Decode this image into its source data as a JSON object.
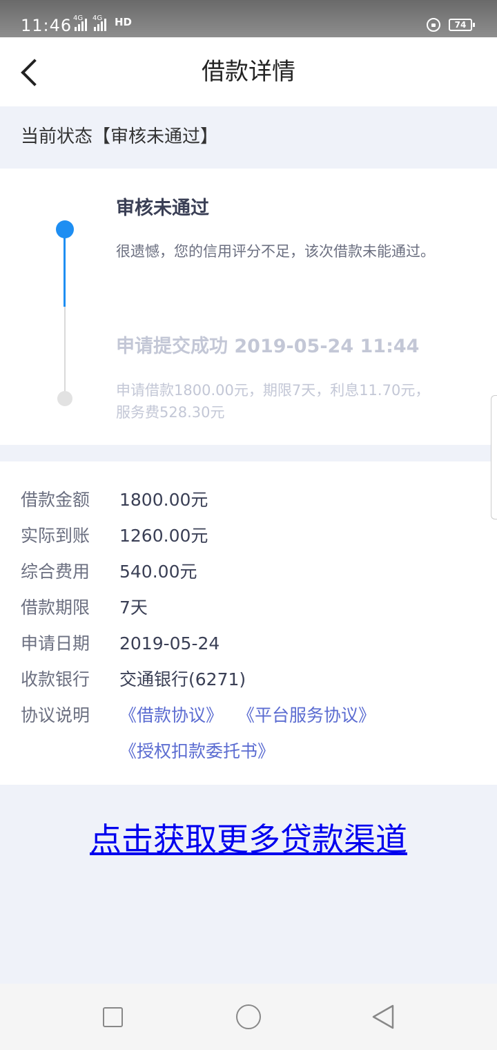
{
  "status_bar": {
    "time": "11:46",
    "net1": "4G",
    "net2": "4G",
    "hd": "HD",
    "battery": "74"
  },
  "header": {
    "title": "借款详情"
  },
  "status": {
    "text": "当前状态【审核未通过】"
  },
  "timeline": {
    "steps": [
      {
        "title": "审核未通过",
        "desc": "很遗憾，您的信用评分不足，该次借款未能通过。"
      },
      {
        "title": "申请提交成功 2019-05-24 11:44",
        "desc": "申请借款1800.00元，期限7天，利息11.70元，服务费528.30元"
      }
    ]
  },
  "details": {
    "rows": [
      {
        "label": "借款金额",
        "value": "1800.00元"
      },
      {
        "label": "实际到账",
        "value": "1260.00元"
      },
      {
        "label": "综合费用",
        "value": "540.00元"
      },
      {
        "label": "借款期限",
        "value": "7天"
      },
      {
        "label": "申请日期",
        "value": "2019-05-24"
      },
      {
        "label": "收款银行",
        "value": "交通银行(6271)"
      }
    ],
    "agreements": {
      "label": "协议说明",
      "loan": "《借款协议》",
      "platform": "《平台服务协议》",
      "authorization": "《授权扣款委托书》"
    }
  },
  "promo": {
    "link_text": "点击获取更多贷款渠道"
  },
  "colors": {
    "accent": "#1e8ef2",
    "link": "#5b6cd1",
    "promo_link": "#0000ee"
  }
}
